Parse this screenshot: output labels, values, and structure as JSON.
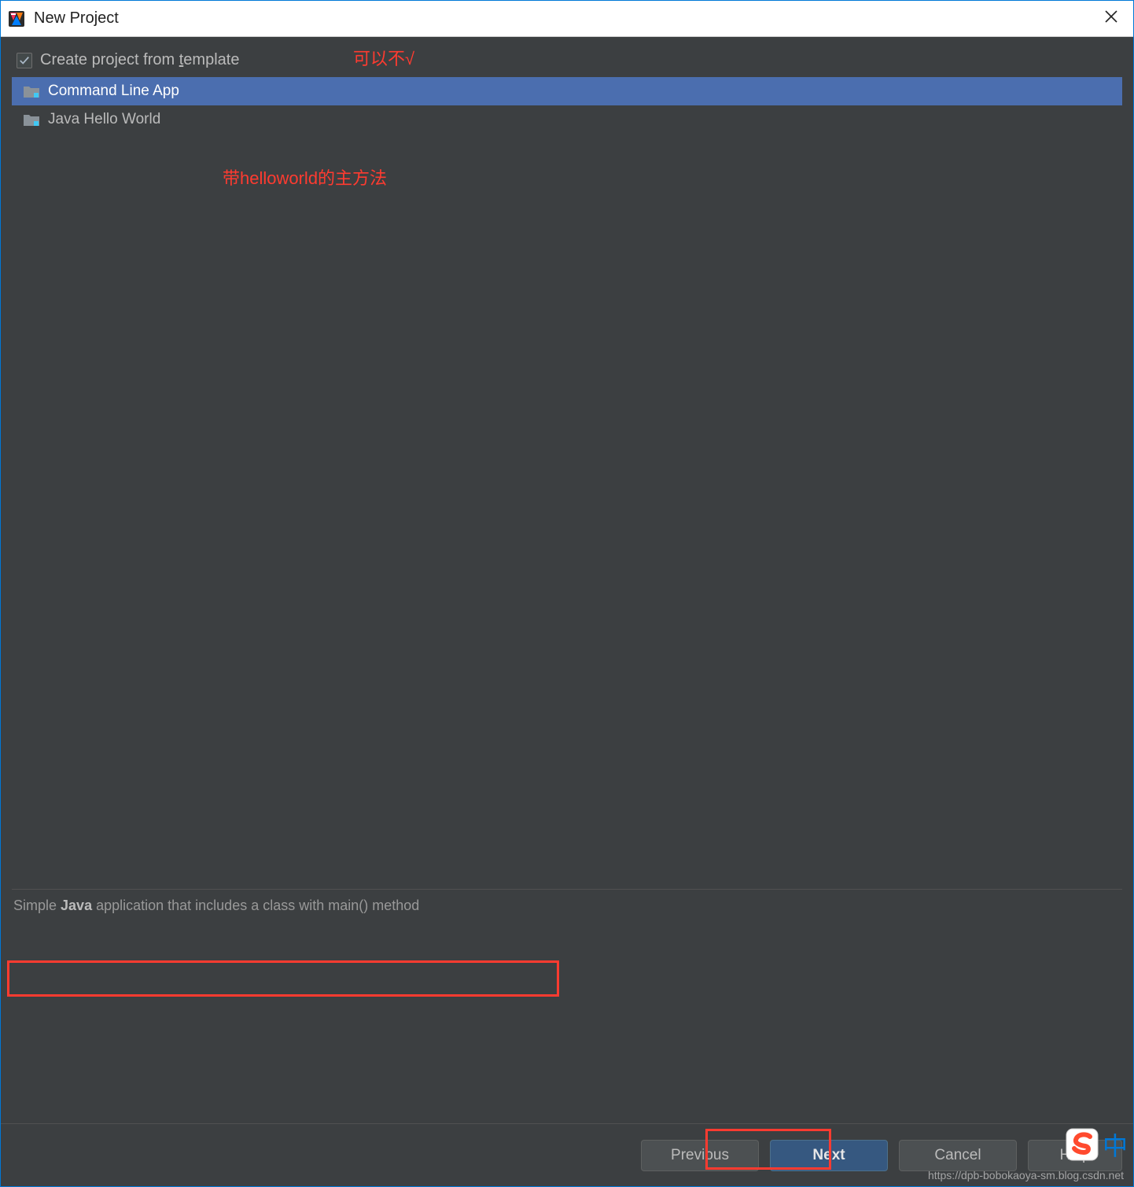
{
  "window": {
    "title": "New Project"
  },
  "checkbox": {
    "label_pre": "Create project from ",
    "underline": "t",
    "label_post": "emplate",
    "checked": true
  },
  "templates": [
    {
      "label": "Command Line App",
      "selected": true
    },
    {
      "label": "Java Hello World",
      "selected": false
    }
  ],
  "description": {
    "pre": "Simple ",
    "bold": "Java",
    "post": " application that includes a class with main() method"
  },
  "buttons": {
    "previous": "Previous",
    "next": "Next",
    "cancel": "Cancel",
    "help": "Help"
  },
  "annotations": {
    "top": "可以不√",
    "hw": "带helloworld的主方法"
  },
  "watermark": "https://dpb-bobokaoya-sm.blog.csdn.net",
  "ime": {
    "char": "中"
  }
}
